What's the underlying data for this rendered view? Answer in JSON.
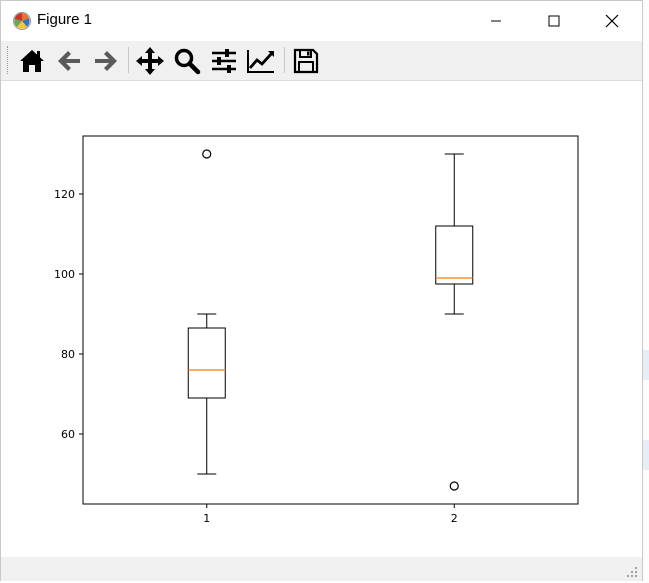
{
  "window": {
    "title": "Figure 1",
    "app_icon": "matplotlib-icon",
    "controls": [
      "minimize-icon",
      "maximize-icon",
      "close-icon"
    ]
  },
  "toolbar": {
    "buttons": [
      {
        "name": "home",
        "icon": "home-icon"
      },
      {
        "name": "back",
        "icon": "arrow-left-icon"
      },
      {
        "name": "forward",
        "icon": "arrow-right-icon"
      },
      {
        "name": "pan",
        "icon": "move-icon"
      },
      {
        "name": "zoom",
        "icon": "magnifier-icon"
      },
      {
        "name": "configure-subplots",
        "icon": "sliders-icon"
      },
      {
        "name": "edit-axis",
        "icon": "line-chart-icon"
      },
      {
        "name": "save",
        "icon": "floppy-disk-icon"
      }
    ]
  },
  "chart_data": {
    "type": "box",
    "categories": [
      "1",
      "2"
    ],
    "boxes": [
      {
        "category": "1",
        "whisker_low": 50,
        "q1": 69,
        "median": 76,
        "q3": 86.5,
        "whisker_high": 90,
        "fliers": [
          130
        ]
      },
      {
        "category": "2",
        "whisker_low": 90,
        "q1": 97.5,
        "median": 99,
        "q3": 112,
        "whisker_high": 130,
        "fliers": [
          47
        ]
      }
    ],
    "yticks": [
      60,
      80,
      100,
      120
    ],
    "ylim": [
      42.5,
      134.5
    ],
    "xlim": [
      0.5,
      2.5
    ],
    "grid": false,
    "colors": {
      "box": "#000000",
      "median": "#ff7f0e"
    }
  }
}
